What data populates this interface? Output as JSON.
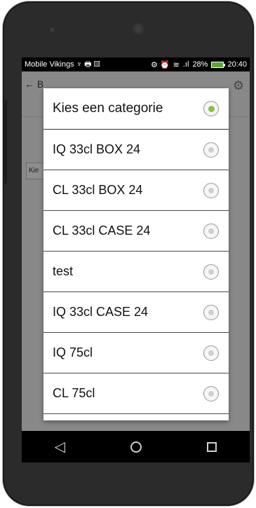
{
  "status": {
    "carrier": "Mobile Vikings",
    "carrier_icons": "♆ 🖶 ▨",
    "alarm_icons": "⚙ ⏰",
    "battery": "28%",
    "time": "20:40"
  },
  "appbar": {
    "back_label": "← B"
  },
  "behind": {
    "button_label": "Kie"
  },
  "dialog": {
    "selected_index": 0,
    "items": [
      {
        "label": "Kies een categorie"
      },
      {
        "label": "IQ 33cl BOX 24"
      },
      {
        "label": "CL 33cl BOX 24"
      },
      {
        "label": "CL 33cl CASE 24"
      },
      {
        "label": "test"
      },
      {
        "label": "IQ 33cl CASE 24"
      },
      {
        "label": "IQ 75cl"
      },
      {
        "label": "CL 75cl"
      }
    ]
  },
  "navbar": {
    "back_icon": "◁"
  }
}
